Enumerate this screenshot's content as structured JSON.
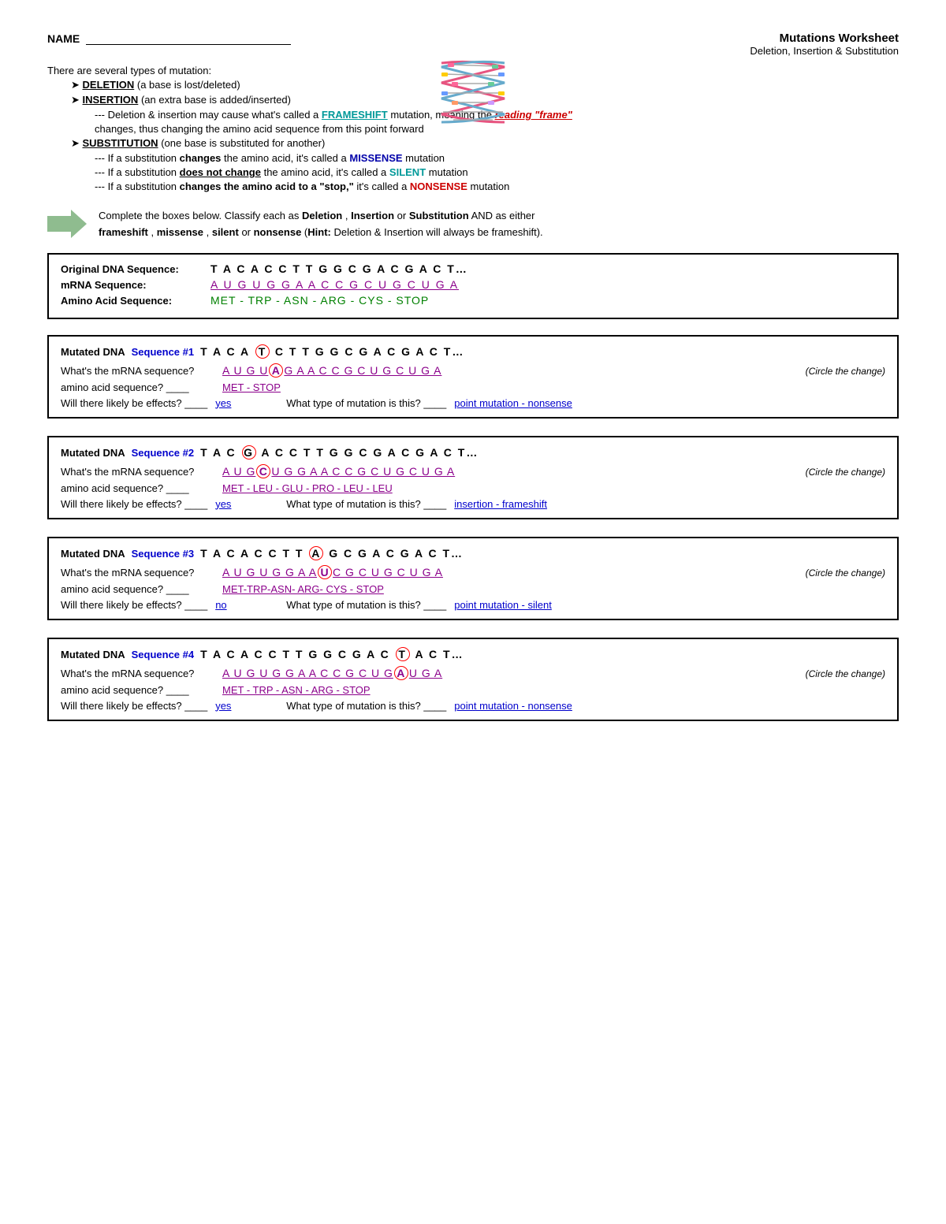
{
  "header": {
    "name_label": "NAME",
    "title": "Mutations Worksheet",
    "subtitle": "Deletion, Insertion & Substitution"
  },
  "intro": {
    "opening": "There are several types of mutation:",
    "deletion_title": "DELETION",
    "deletion_desc": "(a base is lost/deleted)",
    "insertion_title": "INSERTION",
    "insertion_desc": "(an extra base is added/inserted)",
    "frameshift_note1": "--- Deletion & insertion may cause what's called a",
    "frameshift_word": "FRAMESHIFT",
    "frameshift_note2": "mutation, meaning the",
    "reading_frame": "reading \"frame\"",
    "frameshift_note3": "changes, thus changing the amino acid sequence from this point forward",
    "substitution_title": "SUBSTITUTION",
    "substitution_desc": "(one base is substituted for another)",
    "sub1_pre": "--- If a substitution",
    "sub1_bold": "changes",
    "sub1_mid": "the amino acid, it's called a",
    "sub1_word": "MISSENSE",
    "sub1_post": "mutation",
    "sub2_pre": "--- If a substitution",
    "sub2_bold": "does not change",
    "sub2_mid": "the amino acid, it's called a",
    "sub2_word": "SILENT",
    "sub2_post": "mutation",
    "sub3_pre": "--- If a substitution",
    "sub3_bold": "changes the amino acid to a \"stop,\"",
    "sub3_mid": "it's called a",
    "sub3_word": "NONSENSE",
    "sub3_post": "mutation"
  },
  "arrow_section": {
    "text1": "Complete the boxes below.  Classify each as",
    "bold1": "Deletion",
    "text2": ",",
    "bold2": "Insertion",
    "text3": "or",
    "bold3": "Substitution",
    "text4": "AND as either",
    "bold4": "frameshift",
    "text5": ",",
    "bold5": "missense",
    "text6": ",",
    "bold6": "silent",
    "text7": "or",
    "bold7": "nonsense",
    "text8": "(",
    "hint": "Hint:",
    "text9": "Deletion & Insertion will always be frameshift)."
  },
  "original_box": {
    "label1": "Original DNA Sequence:",
    "dna": "T A C A C C T T G G C G A C G A C T",
    "ellipsis": "…",
    "label2": "mRNA Sequence:",
    "mrna": "A U G U G G A A C C G C U G C U G A",
    "label3": "Amino Acid Sequence:",
    "amino": "MET - TRP - ASN - ARG - CYS - STOP"
  },
  "mutations": [
    {
      "id": "1",
      "label": "Mutated DNA",
      "seq_label": "Sequence #1",
      "dna_pre": "T A C A",
      "circled_letter": "T",
      "dna_post": "C T T G G C G A C G A C T",
      "mrna_pre": "A U G U",
      "mrna_circled": "A",
      "mrna_post": "G A A C C G C U G C U G A",
      "circle_the_change": "(Circle the change)",
      "amino_label": "amino acid sequence?",
      "amino_answer": "MET - STOP",
      "effects_label": "Will there likely be effects?",
      "effects_answer": "yes",
      "type_label": "What type of mutation is this?",
      "type_answer": "point mutation - nonsense"
    },
    {
      "id": "2",
      "label": "Mutated DNA",
      "seq_label": "Sequence #2",
      "dna_pre": "T A C",
      "circled_letter": "G",
      "dna_post": "A C C T T G G C G A C G A C T",
      "mrna_pre": "A U G",
      "mrna_circled": "C",
      "mrna_post": "U G G A A C C G C U G C U G A",
      "circle_the_change": "(Circle the change)",
      "amino_label": "amino acid sequence?",
      "amino_answer": "MET - LEU - GLU - PRO - LEU - LEU",
      "effects_label": "Will there likely be effects?",
      "effects_answer": "yes",
      "type_label": "What type of mutation is this?",
      "type_answer": "insertion - frameshift"
    },
    {
      "id": "3",
      "label": "Mutated DNA",
      "seq_label": "Sequence #3",
      "dna_pre": "T A C A C C T T",
      "circled_letter": "A",
      "dna_post": "G C G A C G A C T",
      "mrna_pre": "A U G U G G A A",
      "mrna_circled": "U",
      "mrna_post": "C G C U G C U G A",
      "circle_the_change": "(Circle the change)",
      "amino_label": "amino acid sequence?",
      "amino_answer": "MET-TRP-ASN- ARG- CYS - STOP",
      "effects_label": "Will there likely be effects?",
      "effects_answer": "no",
      "type_label": "What type of mutation is this?",
      "type_answer": "point mutation - silent"
    },
    {
      "id": "4",
      "label": "Mutated DNA",
      "seq_label": "Sequence #4",
      "dna_pre": "T A C A C C T T G G C G A C",
      "circled_letter": "T",
      "dna_post": "A C T",
      "mrna_pre": "A U G U G G A A C C G C U G",
      "mrna_circled": "A",
      "mrna_post": "U G A",
      "circle_the_change": "(Circle the change)",
      "amino_label": "amino acid sequence?",
      "amino_answer": "MET - TRP - ASN - ARG - STOP",
      "effects_label": "Will there likely be effects?",
      "effects_answer": "yes",
      "type_label": "What type of mutation is this?",
      "type_answer": "point mutation - nonsense"
    }
  ]
}
